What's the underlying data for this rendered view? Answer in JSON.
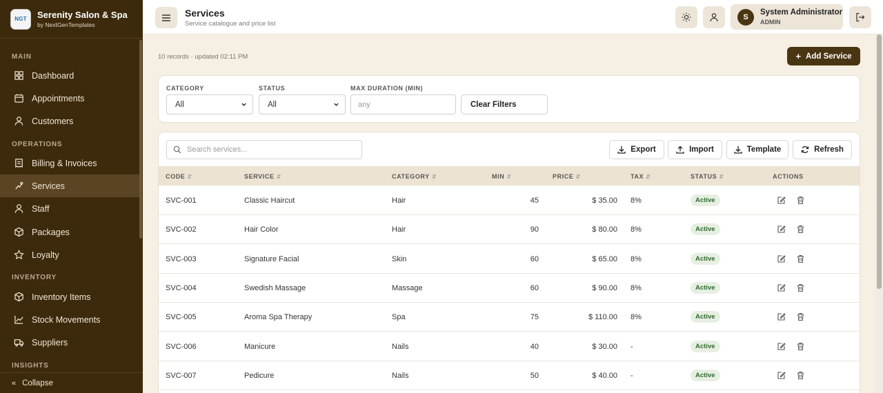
{
  "brand": {
    "name": "Serenity Salon & Spa",
    "sub": "by NextGenTemplates",
    "logo_text": "NGT"
  },
  "sidebar": {
    "sections": [
      {
        "label": "MAIN"
      },
      {
        "label": "OPERATIONS"
      },
      {
        "label": "INVENTORY"
      },
      {
        "label": "INSIGHTS"
      }
    ],
    "items": [
      {
        "label": "Dashboard",
        "icon": "dashboard-icon"
      },
      {
        "label": "Appointments",
        "icon": "calendar-icon"
      },
      {
        "label": "Customers",
        "icon": "user-icon"
      },
      {
        "label": "Billing & Invoices",
        "icon": "billing-icon"
      },
      {
        "label": "Services",
        "icon": "services-icon",
        "active": true
      },
      {
        "label": "Staff",
        "icon": "staff-icon"
      },
      {
        "label": "Packages",
        "icon": "package-icon"
      },
      {
        "label": "Loyalty",
        "icon": "star-icon"
      },
      {
        "label": "Inventory Items",
        "icon": "box-icon"
      },
      {
        "label": "Stock Movements",
        "icon": "chart-icon"
      },
      {
        "label": "Suppliers",
        "icon": "truck-icon"
      }
    ],
    "collapse_label": "Collapse"
  },
  "header": {
    "title": "Services",
    "subtitle": "Service catalogue and price list",
    "user_initial": "S",
    "user_name": "System Administrator",
    "user_role": "ADMIN"
  },
  "meta_text": "10 records · updated 02:11 PM",
  "add_button": "Add Service",
  "filters": {
    "category_label": "CATEGORY",
    "category_value": "All",
    "status_label": "STATUS",
    "status_value": "All",
    "duration_label": "MAX DURATION (MIN)",
    "duration_placeholder": "any",
    "clear_label": "Clear Filters"
  },
  "toolbar": {
    "search_placeholder": "Search services...",
    "export": "Export",
    "import": "Import",
    "template": "Template",
    "refresh": "Refresh"
  },
  "table": {
    "columns": [
      "CODE",
      "SERVICE",
      "CATEGORY",
      "MIN",
      "PRICE",
      "TAX",
      "STATUS",
      "ACTIONS"
    ],
    "rows": [
      {
        "code": "SVC-001",
        "service": "Classic Haircut",
        "category": "Hair",
        "min": "45",
        "price": "$ 35.00",
        "tax": "8%",
        "status": "Active"
      },
      {
        "code": "SVC-002",
        "service": "Hair Color",
        "category": "Hair",
        "min": "90",
        "price": "$ 80.00",
        "tax": "8%",
        "status": "Active"
      },
      {
        "code": "SVC-003",
        "service": "Signature Facial",
        "category": "Skin",
        "min": "60",
        "price": "$ 65.00",
        "tax": "8%",
        "status": "Active"
      },
      {
        "code": "SVC-004",
        "service": "Swedish Massage",
        "category": "Massage",
        "min": "60",
        "price": "$ 90.00",
        "tax": "8%",
        "status": "Active"
      },
      {
        "code": "SVC-005",
        "service": "Aroma Spa Therapy",
        "category": "Spa",
        "min": "75",
        "price": "$ 110.00",
        "tax": "8%",
        "status": "Active"
      },
      {
        "code": "SVC-006",
        "service": "Manicure",
        "category": "Nails",
        "min": "40",
        "price": "$ 30.00",
        "tax": "-",
        "status": "Active"
      },
      {
        "code": "SVC-007",
        "service": "Pedicure",
        "category": "Nails",
        "min": "50",
        "price": "$ 40.00",
        "tax": "-",
        "status": "Active"
      }
    ]
  }
}
